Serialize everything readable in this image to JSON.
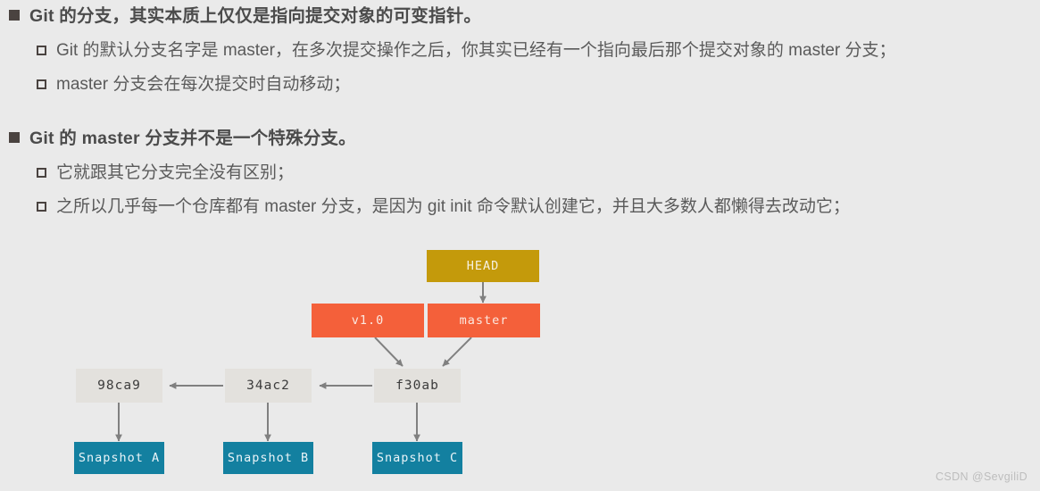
{
  "slide": {
    "background_color": "#eaeaea",
    "bullets": [
      {
        "level": 1,
        "marker": "filled-square",
        "text": "Git 的分支，其实本质上仅仅是指向提交对象的可变指针。"
      },
      {
        "level": 2,
        "marker": "hollow-square",
        "text": "Git 的默认分支名字是 master，在多次提交操作之后，你其实已经有一个指向最后那个提交对象的 master 分支；"
      },
      {
        "level": 2,
        "marker": "hollow-square",
        "text": "master 分支会在每次提交时自动移动；"
      },
      {
        "level": 1,
        "marker": "filled-square",
        "text": "Git 的 master 分支并不是一个特殊分支。"
      },
      {
        "level": 2,
        "marker": "hollow-square",
        "text": "它就跟其它分支完全没有区别；"
      },
      {
        "level": 2,
        "marker": "hollow-square",
        "text": "之所以几乎每一个仓库都有 master 分支，是因为 git init 命令默认创建它，并且大多数人都懒得去改动它；"
      }
    ]
  },
  "diagram": {
    "type": "git-branch-graph",
    "nodes": {
      "head": {
        "label": "HEAD",
        "color": "#c49a0b",
        "kind": "head-pointer"
      },
      "tag": {
        "label": "v1.0",
        "color": "#f4603a",
        "kind": "tag-ref"
      },
      "branch": {
        "label": "master",
        "color": "#f4603a",
        "kind": "branch-ref"
      },
      "commits": [
        {
          "label": "98ca9",
          "color": "#e3e1dd"
        },
        {
          "label": "34ac2",
          "color": "#e3e1dd"
        },
        {
          "label": "f30ab",
          "color": "#e3e1dd"
        }
      ],
      "snapshots": [
        {
          "label": "Snapshot A",
          "color": "#1380a0"
        },
        {
          "label": "Snapshot B",
          "color": "#1380a0"
        },
        {
          "label": "Snapshot C",
          "color": "#1380a0"
        }
      ]
    },
    "edges": [
      {
        "from": "head",
        "to": "branch"
      },
      {
        "from": "tag",
        "to": "f30ab"
      },
      {
        "from": "branch",
        "to": "f30ab"
      },
      {
        "from": "f30ab",
        "to": "34ac2"
      },
      {
        "from": "34ac2",
        "to": "98ca9"
      },
      {
        "from": "98ca9",
        "to": "Snapshot A"
      },
      {
        "from": "34ac2",
        "to": "Snapshot B"
      },
      {
        "from": "f30ab",
        "to": "Snapshot C"
      }
    ],
    "arrow_color": "#808080"
  },
  "watermark": {
    "text": "CSDN @SevgiliD"
  }
}
